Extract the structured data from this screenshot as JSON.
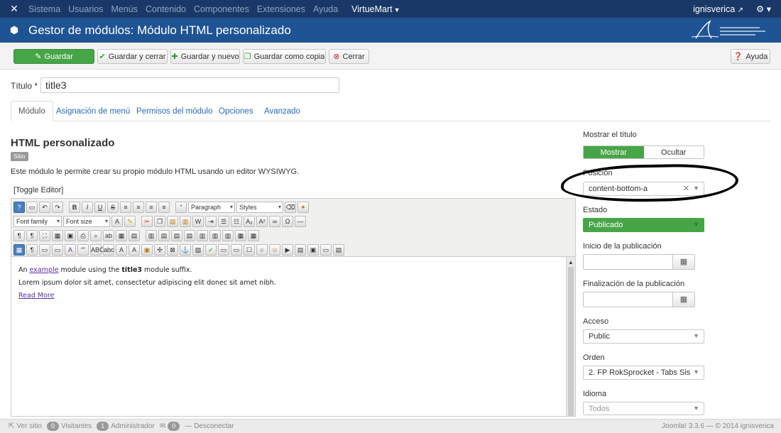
{
  "topnav": {
    "menu": [
      "Sistema",
      "Usuarios",
      "Menús",
      "Contenido",
      "Componentes",
      "Extensiones",
      "Ayuda"
    ],
    "active": "VirtueMart",
    "user": "ignisverica"
  },
  "header": {
    "title": "Gestor de módulos: Módulo HTML personalizado"
  },
  "toolbar": {
    "save": "Guardar",
    "save_close": "Guardar y cerrar",
    "save_new": "Guardar y nuevo",
    "save_copy": "Guardar como copia",
    "close": "Cerrar",
    "help": "Ayuda"
  },
  "form": {
    "title_label": "Título *",
    "title_value": "title3"
  },
  "tabs": [
    "Módulo",
    "Asignación de menú",
    "Permisos del módulo",
    "Opciones",
    "Avanzado"
  ],
  "module": {
    "heading": "HTML personalizado",
    "badge": "Sitio",
    "description": "Este módulo le permite crear su propio módulo HTML usando un editor WYSIWYG.",
    "toggle": "[Toggle Editor]"
  },
  "editor": {
    "format_select": "Paragraph",
    "styles_select": "Styles",
    "font_family": "Font family",
    "font_size": "Font size",
    "line1": {
      "a": "An ",
      "link": "example",
      "b": " module using the ",
      "bold": "title3",
      "c": " module suffix."
    },
    "line2": "Lorem ipsum dolor sit amet, consectetur adipiscing elit donec sit amet nibh.",
    "read_more": "Read More"
  },
  "side": {
    "show_title_label": "Mostrar el título",
    "show": "Mostrar",
    "hide": "Ocultar",
    "position_label": "Posición",
    "position_value": "content-bottom-a",
    "status_label": "Estado",
    "status_value": "Publicado",
    "publish_up_label": "Inicio de la publicación",
    "publish_down_label": "Finalización de la publicación",
    "access_label": "Acceso",
    "access_value": "Public",
    "order_label": "Orden",
    "order_value": "2. FP RokSprocket - Tabs Sis",
    "language_label": "Idioma",
    "language_value": "Todos"
  },
  "status": {
    "view_site": "Ver sitio",
    "visitors_count": "0",
    "visitors": "Visitantes",
    "admins_count": "1",
    "admins": "Administrador",
    "messages_count": "0",
    "logout": "Desconectar",
    "version": "Joomla! 3.3.6 — © 2014 ignisverica"
  },
  "colors": {
    "nav": "#1a3867",
    "header": "#1f5494",
    "green": "#46a546"
  }
}
